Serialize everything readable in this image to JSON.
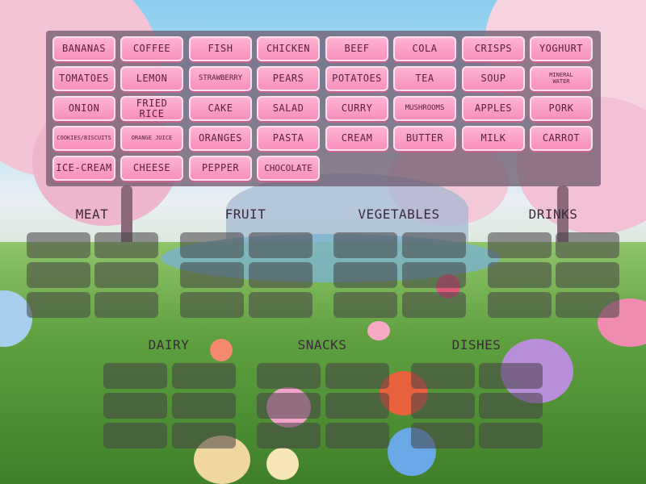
{
  "word_bank": {
    "rows": [
      [
        "BANANAS",
        "COFFEE",
        "FISH",
        "CHICKEN",
        "BEEF",
        "COLA",
        "CRISPS",
        "YOGHURT"
      ],
      [
        "TOMATOES",
        "LEMON",
        "STRAWBERRY",
        "PEARS",
        "POTATOES",
        "TEA",
        "SOUP",
        "MINERAL WATER"
      ],
      [
        "ONION",
        "FRIED RICE",
        "CAKE",
        "SALAD",
        "CURRY",
        "MUSHROOMS",
        "APPLES",
        "PORK"
      ],
      [
        "COOKIES/BISCUITS",
        "ORANGE JUICE",
        "ORANGES",
        "PASTA",
        "CREAM",
        "BUTTER",
        "MILK",
        "CARROT"
      ],
      [
        "ICE-CREAM",
        "CHEESE",
        "PEPPER",
        "CHOCOLATE"
      ]
    ]
  },
  "categories": {
    "top": [
      "MEAT",
      "FRUIT",
      "VEGETABLES",
      "DRINKS"
    ],
    "bottom": [
      "DAIRY",
      "SNACKS",
      "DISHES"
    ]
  },
  "colors": {
    "tile": "#f78fbd",
    "tile_text": "#5a2040",
    "bank_panel": "#6e5a6e",
    "drop_slot": "#464146"
  }
}
